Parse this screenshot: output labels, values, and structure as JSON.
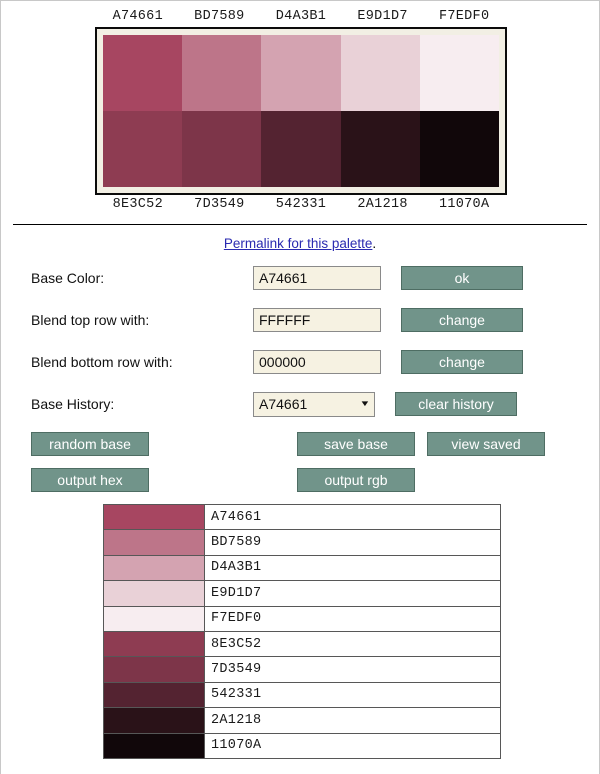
{
  "palette": {
    "top_labels": [
      "A74661",
      "BD7589",
      "D4A3B1",
      "E9D1D7",
      "F7EDF0"
    ],
    "bottom_labels": [
      "8E3C52",
      "7D3549",
      "542331",
      "2A1218",
      "11070A"
    ],
    "top_colors": [
      "#A74661",
      "#BD7589",
      "#D4A3B1",
      "#E9D1D7",
      "#F7EDF0"
    ],
    "bottom_colors": [
      "#8E3C52",
      "#7D3549",
      "#542331",
      "#2A1218",
      "#11070A"
    ],
    "frame_border_color": "#0b0b0b",
    "frame_background_color": "#f2efe4"
  },
  "permalink": {
    "text": "Permalink for this palette",
    "trailing": ".",
    "color": "#2a2ab0"
  },
  "form": {
    "base_color": {
      "label": "Base Color:",
      "value": "A74661",
      "placeholder": "A74661",
      "button": "ok"
    },
    "blend_top": {
      "label": "Blend top row with:",
      "value": "FFFFFF",
      "placeholder": "FFFFFF",
      "button": "change"
    },
    "blend_bottom": {
      "label": "Blend bottom row with:",
      "value": "000000",
      "placeholder": "000000",
      "button": "change"
    },
    "base_history": {
      "label": "Base History:",
      "selected": "A74661",
      "options": [
        "A74661"
      ],
      "button": "clear history"
    }
  },
  "actions": {
    "random_base": "random base",
    "save_base": "save base",
    "view_saved": "view saved",
    "output_hex": "output hex",
    "output_rgb": "output rgb"
  },
  "theme": {
    "button_background": "#71948a",
    "button_border": "#4e6d63",
    "button_text": "#ffffff",
    "input_background": "#f6f2e2",
    "input_border": "#8a8a8a"
  },
  "hex_table": {
    "rows": [
      {
        "hex": "A74661",
        "color": "#A74661"
      },
      {
        "hex": "BD7589",
        "color": "#BD7589"
      },
      {
        "hex": "D4A3B1",
        "color": "#D4A3B1"
      },
      {
        "hex": "E9D1D7",
        "color": "#E9D1D7"
      },
      {
        "hex": "F7EDF0",
        "color": "#F7EDF0"
      },
      {
        "hex": "8E3C52",
        "color": "#8E3C52"
      },
      {
        "hex": "7D3549",
        "color": "#7D3549"
      },
      {
        "hex": "542331",
        "color": "#542331"
      },
      {
        "hex": "2A1218",
        "color": "#2A1218"
      },
      {
        "hex": "11070A",
        "color": "#11070A"
      }
    ]
  }
}
